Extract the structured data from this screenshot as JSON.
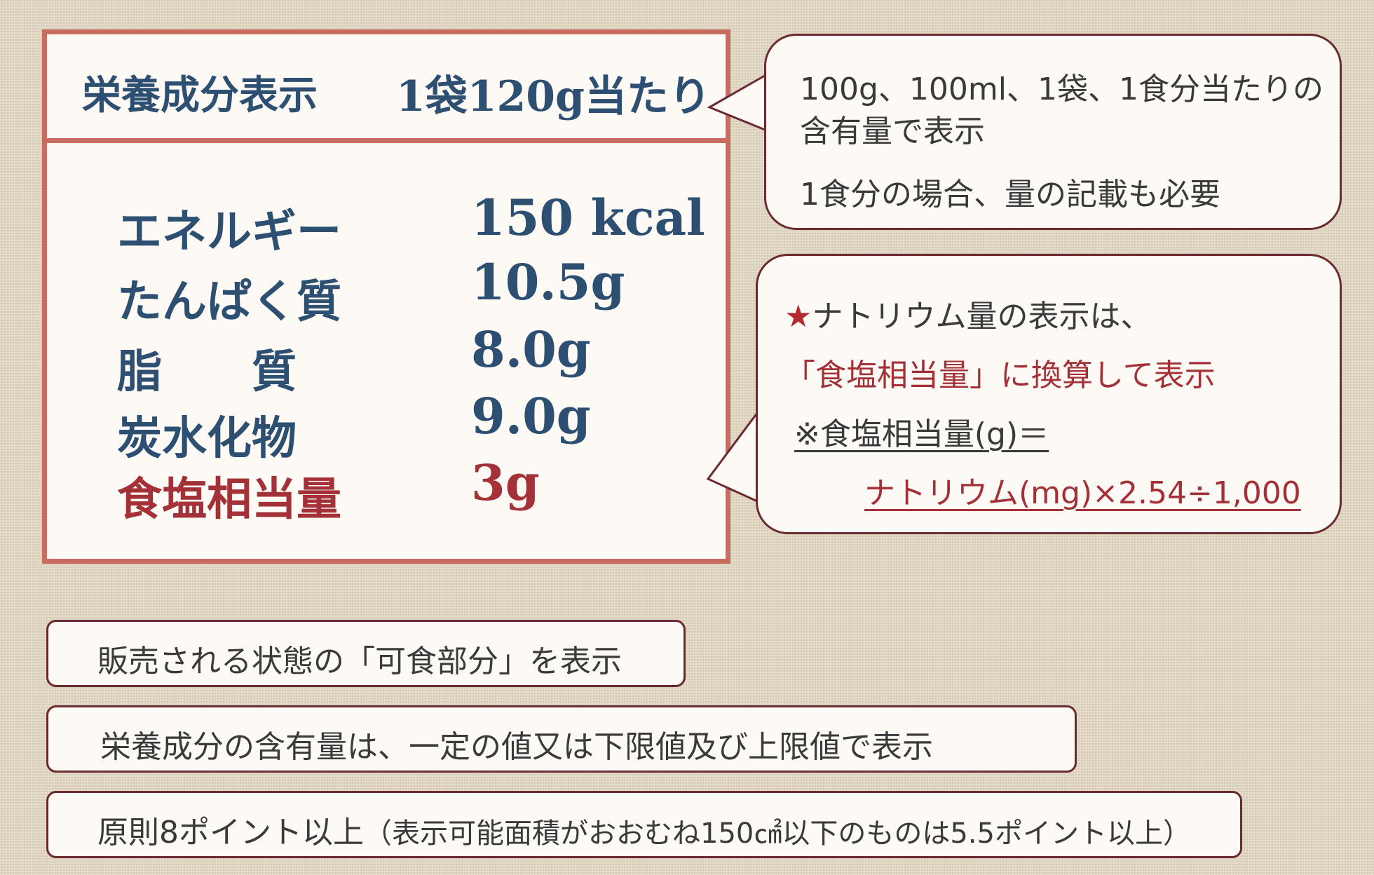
{
  "nutrition_label": {
    "title": "栄養成分表示",
    "serving": "1袋120g当たり",
    "rows": [
      {
        "name": "エネルギー",
        "value": "150 kcal"
      },
      {
        "name": "たんぱく質",
        "value": "10.5g"
      },
      {
        "name": "脂　　質",
        "value": "8.0g"
      },
      {
        "name": "炭水化物",
        "value": "9.0g"
      },
      {
        "name": "食塩相当量",
        "value": "3g"
      }
    ]
  },
  "bubble_serving": {
    "line1": "100g、100ml、1袋、1食分当たりの",
    "line2": "含有量で表示",
    "line3": "1食分の場合、量の記載も必要"
  },
  "bubble_sodium": {
    "star": "★",
    "line1": "ナトリウム量の表示は、",
    "line2": "「食塩相当量」に換算して表示",
    "line3": "※食塩相当量(g)＝",
    "line4": "ナトリウム(mg)×2.54÷1,000"
  },
  "info_boxes": {
    "edible_portion": "販売される状態の「可食部分」を表示",
    "content_value": "栄養成分の含有量は、一定の値又は下限値及び上限値で表示",
    "font_size_main": "原則8ポイント以上",
    "font_size_note": "（表示可能面積がおおむね150㎠以下のものは5.5ポイント以上）"
  }
}
